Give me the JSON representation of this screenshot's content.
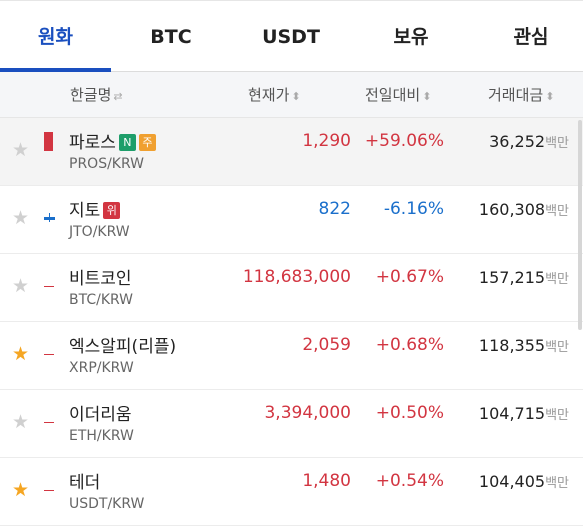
{
  "tabs": [
    {
      "label": "원화",
      "active": true
    },
    {
      "label": "BTC",
      "active": false
    },
    {
      "label": "USDT",
      "active": false
    },
    {
      "label": "보유",
      "active": false
    },
    {
      "label": "관심",
      "active": false
    }
  ],
  "header": {
    "name": "한글명",
    "name_icon": "⇄",
    "price": "현재가",
    "change": "전일대비",
    "volume": "거래대금",
    "sort_icon": "⬍"
  },
  "colors": {
    "up": "#d23541",
    "down": "#1a6fcb",
    "accent": "#1a4fbf",
    "star_fav": "#f5a623",
    "badge_n": "#1e9e6a",
    "badge_ju": "#f0a030",
    "badge_wi": "#d23541"
  },
  "volume_unit": "백만",
  "rows": [
    {
      "name": "파로스",
      "symbol": "PROS/KRW",
      "price": "1,290",
      "change": "+59.06%",
      "volume": "36,252",
      "favorite": false,
      "direction": "up",
      "badges": [
        "N",
        "주"
      ]
    },
    {
      "name": "지토",
      "symbol": "JTO/KRW",
      "price": "822",
      "change": "-6.16%",
      "volume": "160,308",
      "favorite": false,
      "direction": "down",
      "badges": [
        "위"
      ]
    },
    {
      "name": "비트코인",
      "symbol": "BTC/KRW",
      "price": "118,683,000",
      "change": "+0.67%",
      "volume": "157,215",
      "favorite": false,
      "direction": "up",
      "badges": []
    },
    {
      "name": "엑스알피(리플)",
      "symbol": "XRP/KRW",
      "price": "2,059",
      "change": "+0.68%",
      "volume": "118,355",
      "favorite": true,
      "direction": "up",
      "badges": []
    },
    {
      "name": "이더리움",
      "symbol": "ETH/KRW",
      "price": "3,394,000",
      "change": "+0.50%",
      "volume": "104,715",
      "favorite": false,
      "direction": "up",
      "badges": []
    },
    {
      "name": "테더",
      "symbol": "USDT/KRW",
      "price": "1,480",
      "change": "+0.54%",
      "volume": "104,405",
      "favorite": true,
      "direction": "up",
      "badges": []
    }
  ]
}
